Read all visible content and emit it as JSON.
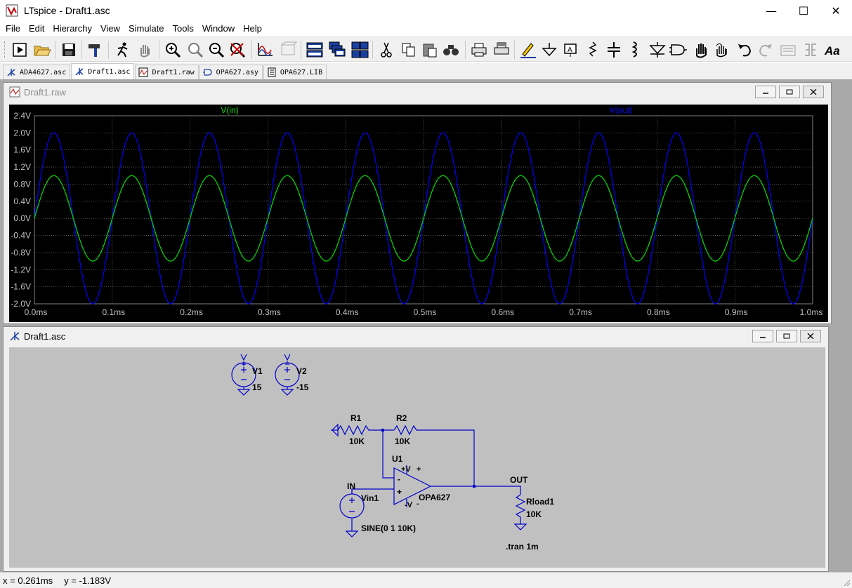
{
  "window": {
    "title": "LTspice - Draft1.asc",
    "minimize": "—",
    "maximize": "☐",
    "close": "✕"
  },
  "menu": [
    "File",
    "Edit",
    "Hierarchy",
    "View",
    "Simulate",
    "Tools",
    "Window",
    "Help"
  ],
  "toolbar_icons": [
    "run-icon",
    "open-folder-icon",
    "save-icon",
    "hammer-icon",
    "running-man-icon",
    "pan-hand-icon",
    "zoom-in-icon",
    "zoom-fit-icon",
    "zoom-out-icon",
    "zoom-cancel-icon",
    "waveform-icon",
    "autorange-icon",
    "tile-horizontal-icon",
    "cascade-icon",
    "tile-windows-icon",
    "cut-icon",
    "copy-icon",
    "paste-icon",
    "find-icon",
    "print-icon",
    "print-preview-icon",
    "wire-pencil-icon",
    "ground-icon",
    "label-icon",
    "resistor-icon",
    "capacitor-icon",
    "inductor-icon",
    "diode-icon",
    "component-icon",
    "move-hand-icon",
    "drag-hand-icon",
    "undo-icon",
    "redo-icon",
    "rotate-icon",
    "mirror-icon",
    "text-icon"
  ],
  "tabs": [
    {
      "label": "ADA4627.asc",
      "icon": "schematic-icon"
    },
    {
      "label": "Draft1.asc",
      "icon": "schematic-icon",
      "active": true
    },
    {
      "label": "Draft1.raw",
      "icon": "waveform-icon"
    },
    {
      "label": "OPA627.asy",
      "icon": "symbol-icon"
    },
    {
      "label": "OPA627.LIB",
      "icon": "netlist-icon"
    }
  ],
  "plot_window": {
    "title": "Draft1.raw"
  },
  "schematic_window": {
    "title": "Draft1.asc"
  },
  "colors": {
    "vin": "#00e000",
    "vout": "#0000ff",
    "wire": "#0000cc",
    "plot_bg": "#000000",
    "sch_bg": "#c0c0c0",
    "text": "#000000"
  },
  "chart_data": {
    "type": "line",
    "xlabel": "",
    "ylabel": "",
    "xlim": [
      0,
      1.0
    ],
    "ylim": [
      -2.0,
      2.4
    ],
    "x_ticks": [
      {
        "value": 0.0,
        "label": "0.0ms"
      },
      {
        "value": 0.1,
        "label": "0.1ms"
      },
      {
        "value": 0.2,
        "label": "0.2ms"
      },
      {
        "value": 0.3,
        "label": "0.3ms"
      },
      {
        "value": 0.4,
        "label": "0.4ms"
      },
      {
        "value": 0.5,
        "label": "0.5ms"
      },
      {
        "value": 0.6,
        "label": "0.6ms"
      },
      {
        "value": 0.7,
        "label": "0.7ms"
      },
      {
        "value": 0.8,
        "label": "0.8ms"
      },
      {
        "value": 0.9,
        "label": "0.9ms"
      },
      {
        "value": 1.0,
        "label": "1.0ms"
      }
    ],
    "y_ticks": [
      {
        "value": 2.4,
        "label": "2.4V"
      },
      {
        "value": 2.0,
        "label": "2.0V"
      },
      {
        "value": 1.6,
        "label": "1.6V"
      },
      {
        "value": 1.2,
        "label": "1.2V"
      },
      {
        "value": 0.8,
        "label": "0.8V"
      },
      {
        "value": 0.4,
        "label": "0.4V"
      },
      {
        "value": 0.0,
        "label": "0.0V"
      },
      {
        "value": -0.4,
        "label": "-0.4V"
      },
      {
        "value": -0.8,
        "label": "-0.8V"
      },
      {
        "value": -1.2,
        "label": "-1.2V"
      },
      {
        "value": -1.6,
        "label": "-1.6V"
      },
      {
        "value": -2.0,
        "label": "-2.0V"
      }
    ],
    "grid": true,
    "series": [
      {
        "name": "V(in)",
        "waveform": "sine",
        "amplitude": 1.0,
        "frequency_khz": 10,
        "phase_deg": 0,
        "color": "#00e000"
      },
      {
        "name": "V(out)",
        "waveform": "sine",
        "amplitude": 2.0,
        "frequency_khz": 10,
        "phase_deg": 0,
        "color": "#0000ff"
      }
    ]
  },
  "schematic": {
    "v1": {
      "name": "V1",
      "value": "15"
    },
    "v2": {
      "name": "V2",
      "value": "-15"
    },
    "r1": {
      "name": "R1",
      "value": "10K"
    },
    "r2": {
      "name": "R2",
      "value": "10K"
    },
    "u1": {
      "name": "U1",
      "model": "OPA627",
      "vplus": "+V",
      "vminus": "-V",
      "plus": "+",
      "minus": "-"
    },
    "vin1": {
      "name": "Vin1",
      "value": "SINE(0 1 10K)",
      "net": "IN"
    },
    "rload": {
      "name": "Rload1",
      "value": "10K"
    },
    "out_label": "OUT",
    "directive": ".tran 1m"
  },
  "status": {
    "x": "x = 0.261ms",
    "y": "y = -1.183V"
  }
}
